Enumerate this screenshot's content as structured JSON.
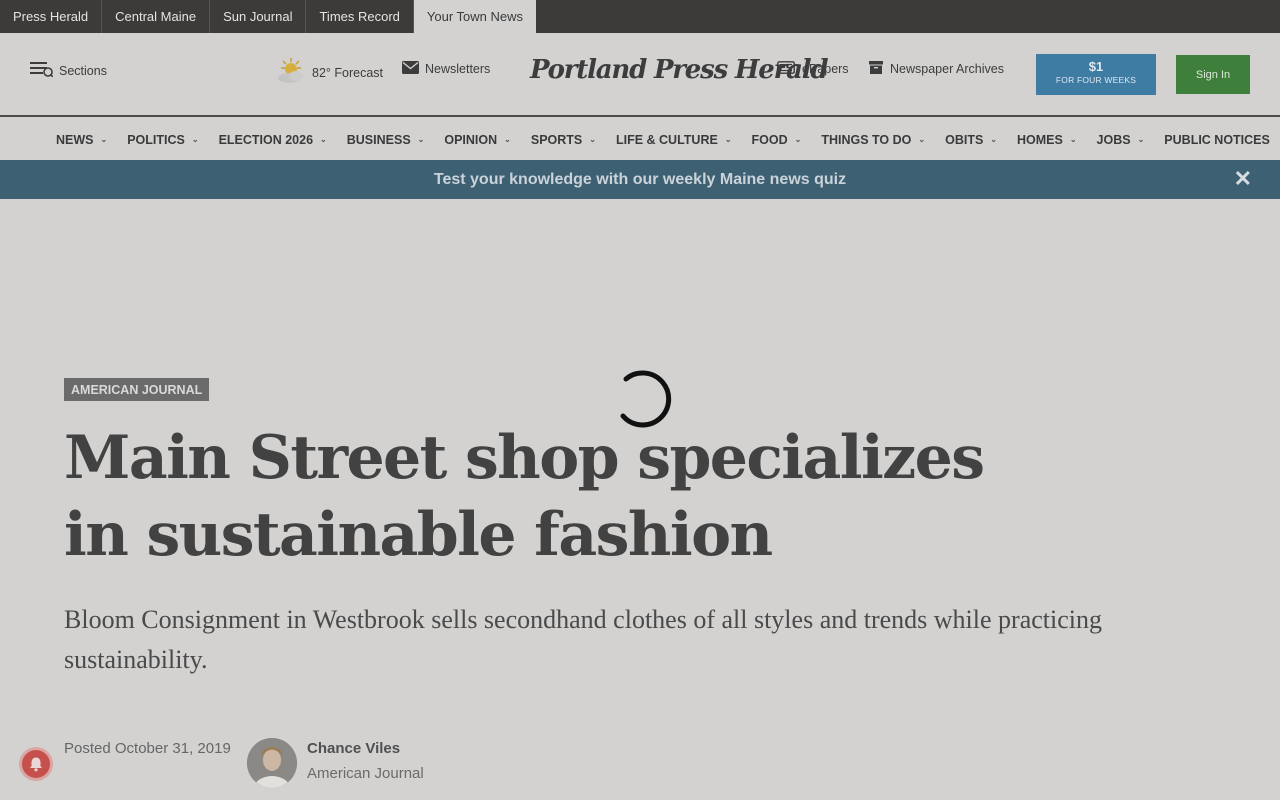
{
  "network_tabs": [
    {
      "label": "Press Herald",
      "active": false
    },
    {
      "label": "Central Maine",
      "active": false
    },
    {
      "label": "Sun Journal",
      "active": false
    },
    {
      "label": "Times Record",
      "active": false
    },
    {
      "label": "Your Town News",
      "active": true
    }
  ],
  "header": {
    "sections_label": "Sections",
    "weather_label": "82° Forecast",
    "newsletters_label": "Newsletters",
    "logo_text": "Portland Press Herald",
    "epapers_label": "ePapers",
    "archives_label": "Newspaper Archives",
    "subscribe_price": "$1",
    "subscribe_sub": "FOR FOUR WEEKS",
    "signin_label": "Sign In"
  },
  "main_nav": [
    {
      "label": "NEWS",
      "has_dropdown": true
    },
    {
      "label": "POLITICS",
      "has_dropdown": true
    },
    {
      "label": "ELECTION 2026",
      "has_dropdown": true
    },
    {
      "label": "BUSINESS",
      "has_dropdown": true
    },
    {
      "label": "OPINION",
      "has_dropdown": true
    },
    {
      "label": "SPORTS",
      "has_dropdown": true
    },
    {
      "label": "LIFE & CULTURE",
      "has_dropdown": true
    },
    {
      "label": "FOOD",
      "has_dropdown": true
    },
    {
      "label": "THINGS TO DO",
      "has_dropdown": true
    },
    {
      "label": "OBITS",
      "has_dropdown": true
    },
    {
      "label": "HOMES",
      "has_dropdown": true
    },
    {
      "label": "JOBS",
      "has_dropdown": true
    },
    {
      "label": "PUBLIC NOTICES",
      "has_dropdown": false
    }
  ],
  "banner": {
    "text": "Test your knowledge with our weekly Maine news quiz",
    "close_glyph": "✕"
  },
  "article": {
    "kicker": "AMERICAN JOURNAL",
    "headline": "Main Street shop specializes in sustainable fashion",
    "dek": "Bloom Consignment in Westbrook sells secondhand clothes of all styles and trends while practicing sustainability.",
    "posted": "Posted October 31, 2019",
    "author_name": "Chance Viles",
    "author_org": "American Journal"
  },
  "colors": {
    "page_bg": "#d3d2d1",
    "netbar_bg": "#3c3b3a",
    "banner_bg": "#3e6073",
    "subscribe_bg": "#3f7ca3",
    "signin_bg": "#3f7f3c",
    "bell_bg": "#c6504c"
  },
  "icons": {
    "sections": "menu-list-icon",
    "weather": "sun-cloud-icon",
    "newsletters": "envelope-icon",
    "epapers": "newspaper-icon",
    "archives": "archive-box-icon",
    "close": "close-icon",
    "loading": "spinner-icon",
    "notifications": "bell-icon"
  }
}
